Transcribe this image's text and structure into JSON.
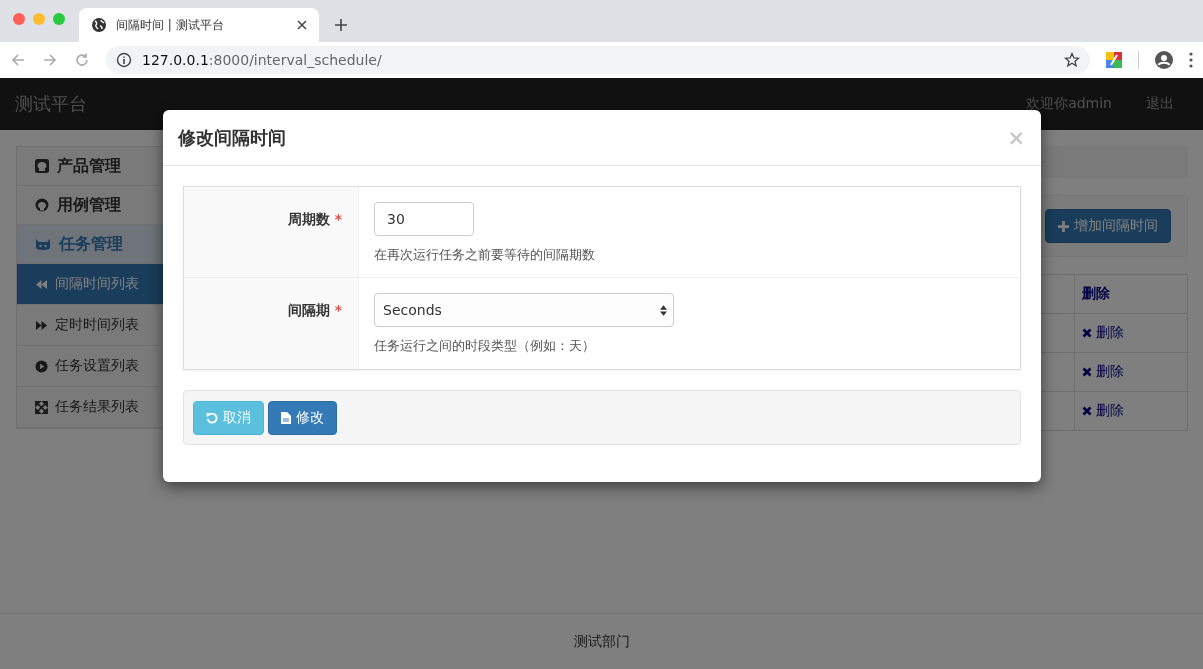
{
  "browser": {
    "tab_title": "间隔时间 | 测试平台",
    "url_host": "127.0.0.1",
    "url_rest": ":8000/interval_schedule/"
  },
  "navbar": {
    "brand": "测试平台",
    "user": "欢迎你admin",
    "logout": "退出"
  },
  "sidebar": {
    "groups": [
      {
        "label": "产品管理",
        "selected": false
      },
      {
        "label": "用例管理",
        "selected": false
      },
      {
        "label": "任务管理",
        "selected": true,
        "expanded": true,
        "children": [
          {
            "label": "间隔时间列表",
            "selected": true
          },
          {
            "label": "定时时间列表",
            "selected": false
          },
          {
            "label": "任务设置列表",
            "selected": false
          },
          {
            "label": "任务结果列表",
            "selected": false
          }
        ]
      }
    ]
  },
  "main": {
    "add_button": "增加间隔时间",
    "table": {
      "column_header": "删除",
      "rows": [
        {
          "action": "删除"
        },
        {
          "action": "删除"
        },
        {
          "action": "删除"
        }
      ]
    }
  },
  "modal": {
    "title": "修改间隔时间",
    "close": "×",
    "fields": [
      {
        "label": "周期数",
        "required_mark": "*",
        "kind": "input",
        "value": "30",
        "help": "在再次运行任务之前要等待的间隔期数"
      },
      {
        "label": "间隔期",
        "required_mark": "*",
        "kind": "select",
        "value": "Seconds",
        "help": "任务运行之间的时段类型（例如：天）"
      }
    ],
    "buttons": [
      {
        "label": "取消",
        "kind": "cancel"
      },
      {
        "label": "修改",
        "kind": "submit"
      }
    ]
  },
  "footer": "测试部门"
}
